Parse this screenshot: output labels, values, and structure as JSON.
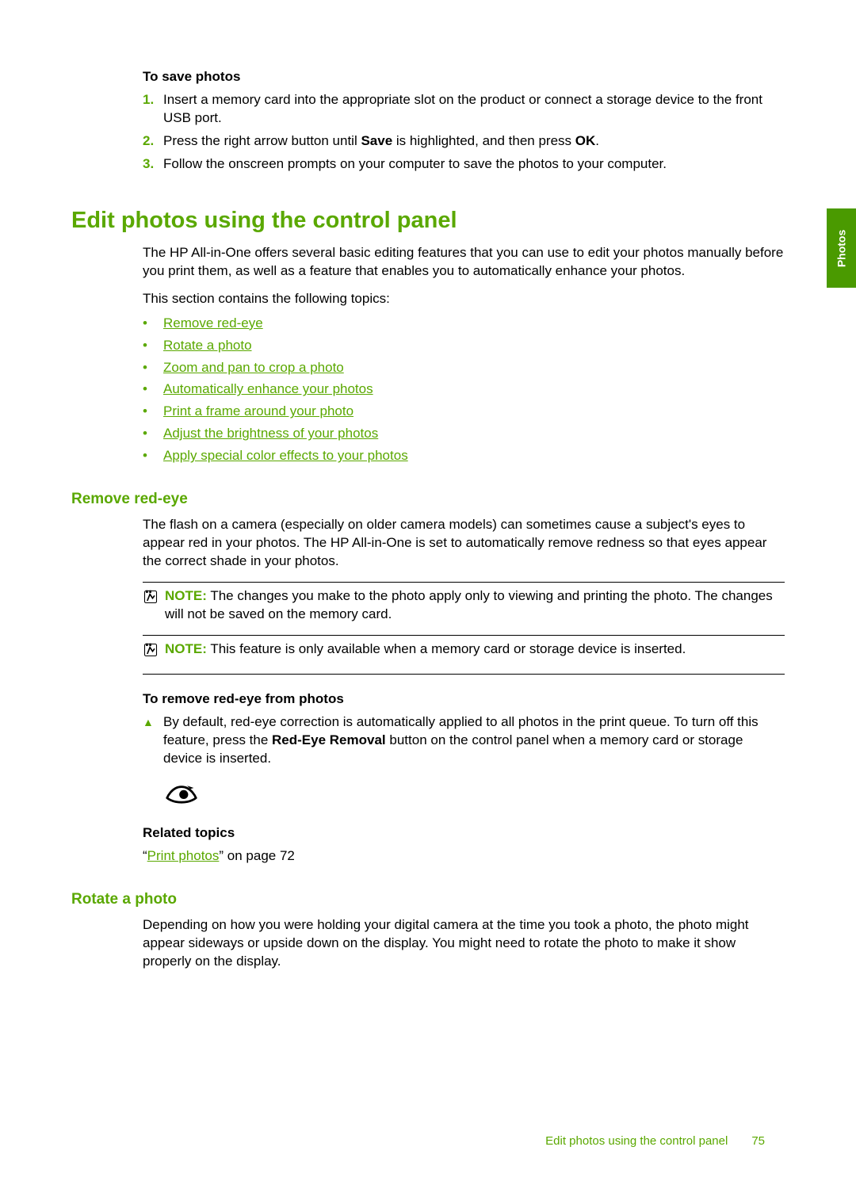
{
  "sideTab": "Photos",
  "save": {
    "heading": "To save photos",
    "steps": {
      "m1": "1.",
      "s1": "Insert a memory card into the appropriate slot on the product or connect a storage device to the front USB port.",
      "m2": "2.",
      "s2a": "Press the right arrow button until ",
      "s2b": "Save",
      "s2c": " is highlighted, and then press ",
      "s2d": "OK",
      "s2e": ".",
      "m3": "3.",
      "s3": "Follow the onscreen prompts on your computer to save the photos to your computer."
    }
  },
  "h1": "Edit photos using the control panel",
  "intro": "The HP All-in-One offers several basic editing features that you can use to edit your photos manually before you print them, as well as a feature that enables you to automatically enhance your photos.",
  "intro2": "This section contains the following topics:",
  "links": {
    "l1": "Remove red-eye",
    "l2": "Rotate a photo",
    "l3": "Zoom and pan to crop a photo",
    "l4": "Automatically enhance your photos",
    "l5": "Print a frame around your photo",
    "l6": "Adjust the brightness of your photos",
    "l7": "Apply special color effects to your photos"
  },
  "redeye": {
    "h2": "Remove red-eye",
    "para": "The flash on a camera (especially on older camera models) can sometimes cause a subject's eyes to appear red in your photos. The HP All-in-One is set to automatically remove redness so that eyes appear the correct shade in your photos.",
    "noteLabel": "NOTE:",
    "note1": "The changes you make to the photo apply only to viewing and printing the photo. The changes will not be saved on the memory card.",
    "note2": "This feature is only available when a memory card or storage device is inserted.",
    "procH": "To remove red-eye from photos",
    "stepA": "By default, red-eye correction is automatically applied to all photos in the print queue. To turn off this feature, press the ",
    "stepB": "Red-Eye Removal",
    "stepC": " button on the control panel when a memory card or storage device is inserted.",
    "relH": "Related topics",
    "relQ1": "“",
    "relLink": "Print photos",
    "relQ2": "” on page 72"
  },
  "rotate": {
    "h2": "Rotate a photo",
    "para": "Depending on how you were holding your digital camera at the time you took a photo, the photo might appear sideways or upside down on the display. You might need to rotate the photo to make it show properly on the display."
  },
  "footer": {
    "title": "Edit photos using the control panel",
    "page": "75"
  }
}
